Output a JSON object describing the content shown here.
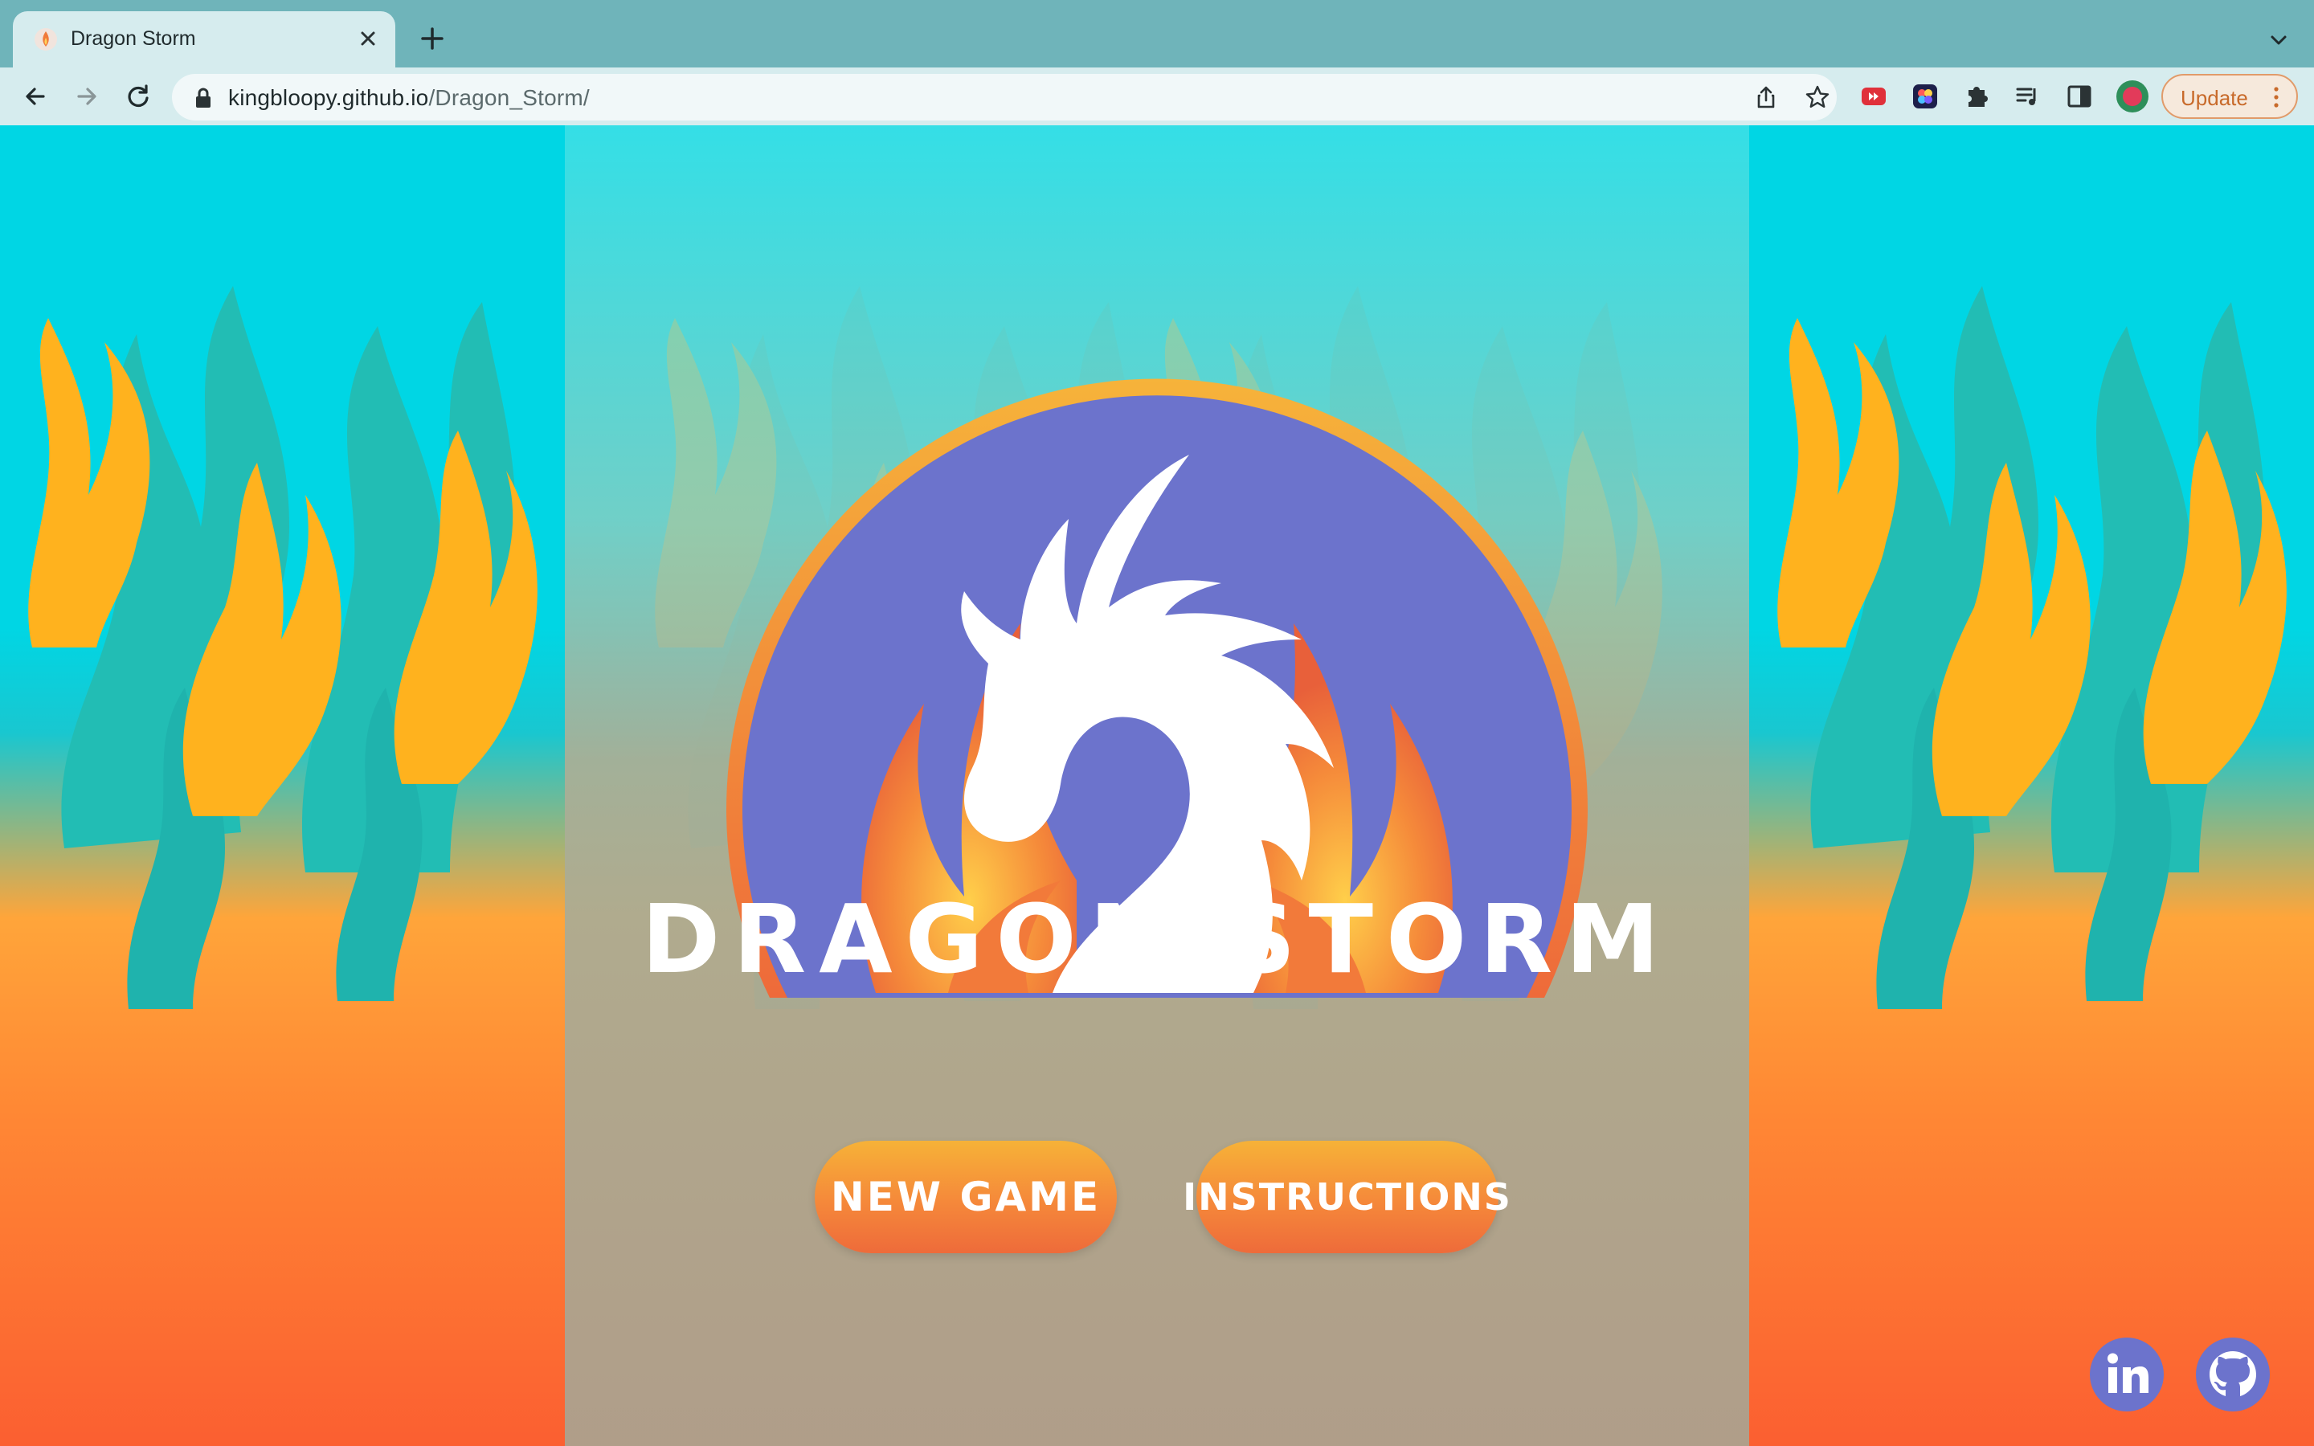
{
  "browser": {
    "tab_title": "Dragon Storm",
    "url_host": "kingbloopy.github.io",
    "url_path": "/Dragon_Storm/",
    "update_label": "Update"
  },
  "game": {
    "title": "DRAGON STORM",
    "new_game_label": "NEW GAME",
    "instructions_label": "INSTRUCTIONS"
  },
  "colors": {
    "sky": "#00d6e4",
    "flame_orange": "#fb5f31",
    "badge_purple": "#6c73cc",
    "button_orange": "#f5883a"
  },
  "icons": {
    "linkedin": "linkedin-icon",
    "github": "github-icon"
  }
}
